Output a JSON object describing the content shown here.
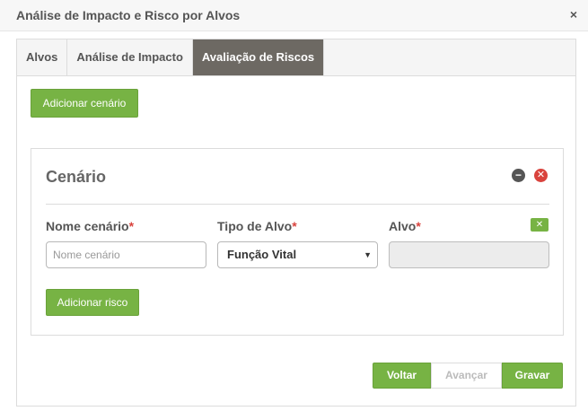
{
  "dialog": {
    "title": "Análise de Impacto e Risco por Alvos",
    "close_label": "×"
  },
  "tabs": [
    {
      "label": "Alvos",
      "active": false
    },
    {
      "label": "Análise de Impacto",
      "active": false
    },
    {
      "label": "Avaliação de Riscos",
      "active": true
    }
  ],
  "add_scenario_label": "Adicionar cenário",
  "scenario": {
    "title": "Cenário",
    "minimize_icon": "minus-circle-icon",
    "remove_icon": "close-circle-icon",
    "fields": {
      "name": {
        "label": "Nome cenário",
        "required_mark": "*",
        "value": "",
        "placeholder": "Nome cenário"
      },
      "type": {
        "label": "Tipo de Alvo",
        "required_mark": "*",
        "value": "Função Vital"
      },
      "target": {
        "label": "Alvo",
        "required_mark": "*",
        "value": ""
      }
    },
    "clear_target_label": "✕",
    "add_risk_label": "Adicionar risco"
  },
  "footer": {
    "back_label": "Voltar",
    "next_label": "Avançar",
    "save_label": "Gravar"
  },
  "colors": {
    "accent_green": "#77b344",
    "active_tab": "#6d6963",
    "danger": "#d9433d"
  }
}
